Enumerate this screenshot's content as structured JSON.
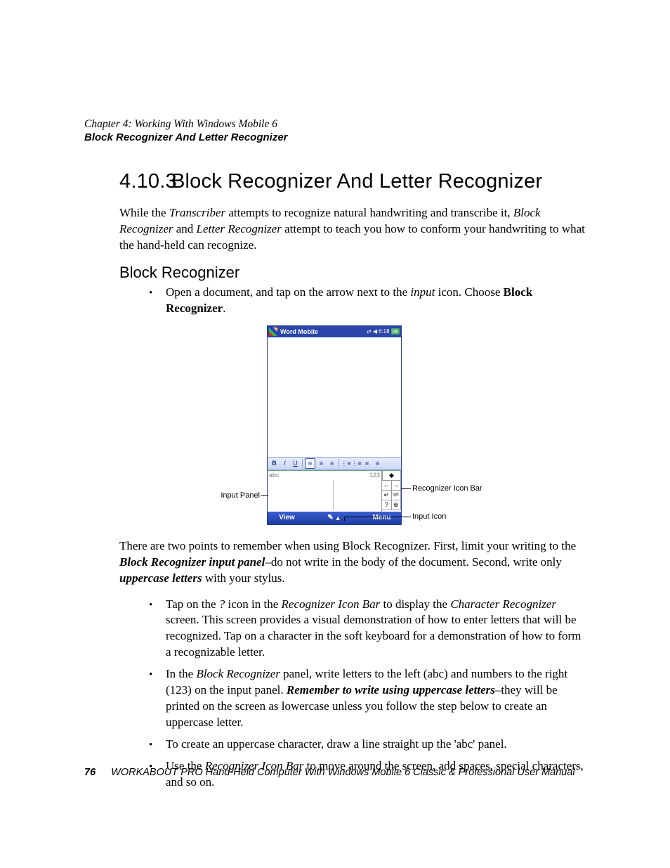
{
  "header": {
    "chapter": "Chapter 4: Working With Windows Mobile 6",
    "section": "Block Recognizer And Letter Recognizer"
  },
  "heading": {
    "number": "4.10.3",
    "title": "Block Recognizer And Letter Recognizer"
  },
  "intro": {
    "p1_a": "While the ",
    "p1_i1": "Transcriber",
    "p1_b": " attempts to recognize natural handwriting and transcribe it, ",
    "p1_i2": "Block Recognizer",
    "p1_c": " and ",
    "p1_i3": "Letter Recognizer",
    "p1_d": " attempt to teach you how to conform your handwriting to what the hand-held can recognize."
  },
  "sub1": "Block Recognizer",
  "bullet1": {
    "a": "Open a document, and tap on the arrow next to the ",
    "i": "input",
    "b": " icon. Choose ",
    "s": "Block Recognizer",
    "c": "."
  },
  "figure": {
    "title": "Word Mobile",
    "time": "6:18",
    "ok": "ok",
    "tb": {
      "b": "B",
      "i": "I",
      "u": "U"
    },
    "abc": "abc",
    "num": "123",
    "view": "View",
    "menu": "Menu",
    "spc": "spc",
    "callouts": {
      "input_panel": "Input Panel",
      "recog_bar": "Recognizer Icon Bar",
      "input_icon": "Input Icon"
    }
  },
  "para2": {
    "a": "There are two points to remember when using Block Recognizer. First, limit your writing to the ",
    "bi1": "Block Recognizer input panel",
    "b": "–do not write in the body of the document. Second, write only ",
    "bi2": "uppercase letters",
    "c": " with your stylus."
  },
  "list2": {
    "li1": {
      "a": "Tap on the ",
      "i1": "?",
      "b": " icon in the ",
      "i2": "Recognizer Icon Bar",
      "c": " to display the ",
      "i3": "Character Recognizer",
      "d": " screen. This screen provides a visual demonstration of how to enter letters that will be recognized. Tap on a character in the soft keyboard for a demonstration of how to form a recognizable letter."
    },
    "li2": {
      "a": "In the ",
      "i1": "Block Recognizer",
      "b": " panel, write letters to the left (abc) and numbers to the right (123) on the input panel. ",
      "bi": "Remember to write using uppercase letters",
      "c": "–they will be printed on the screen as lowercase unless you follow the step below to create an uppercase letter."
    },
    "li3": "To create an uppercase character, draw a line straight up the 'abc' panel.",
    "li4": {
      "a": "Use the ",
      "i1": "Recognizer Icon Bar",
      "b": " to move around the screen, add spaces, special characters, and so on."
    }
  },
  "footer": {
    "page": "76",
    "text": "WORKABOUT PRO Hand-Held Computer With Windows Mobile 6 Classic & Professional User Manual"
  }
}
